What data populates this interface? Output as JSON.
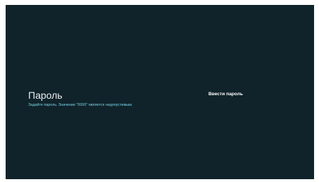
{
  "password_screen": {
    "title": "Пароль",
    "description": "Задайте пароль. Значение \"0000\" является недопустимым.",
    "action_label": "Ввести пароль"
  },
  "colors": {
    "background": "#10232a",
    "title": "#e8eef0",
    "description": "#79d1e6",
    "action": "#ffffff"
  }
}
